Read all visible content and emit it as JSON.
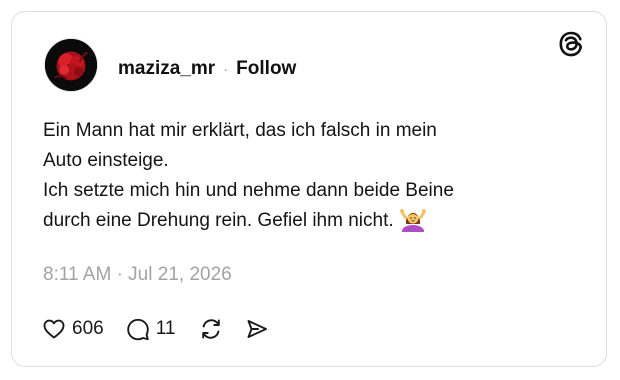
{
  "post": {
    "username": "maziza_mr",
    "separator": "·",
    "follow_label": "Follow",
    "text_lines": [
      "Ein Mann hat mir erklärt, das ich falsch in mein",
      "Auto einsteige.",
      "Ich setzte mich hin und nehme dann beide Beine",
      "durch eine Drehung rein. Gefiel ihm nicht."
    ],
    "trailing_emoji": "🤷‍♀️",
    "timestamp": "8:11 AM · Jul 21, 2026"
  },
  "actions": {
    "likes": "606",
    "replies": "11"
  },
  "icons": {
    "logo": "threads-logo-icon",
    "like": "heart-icon",
    "reply": "comment-bubble-icon",
    "repost": "repost-icon",
    "share": "send-icon"
  },
  "colors": {
    "text": "#101010",
    "muted": "#a3a3a3",
    "border": "#dcdcdc",
    "avatar_accent": "#c8101a"
  }
}
